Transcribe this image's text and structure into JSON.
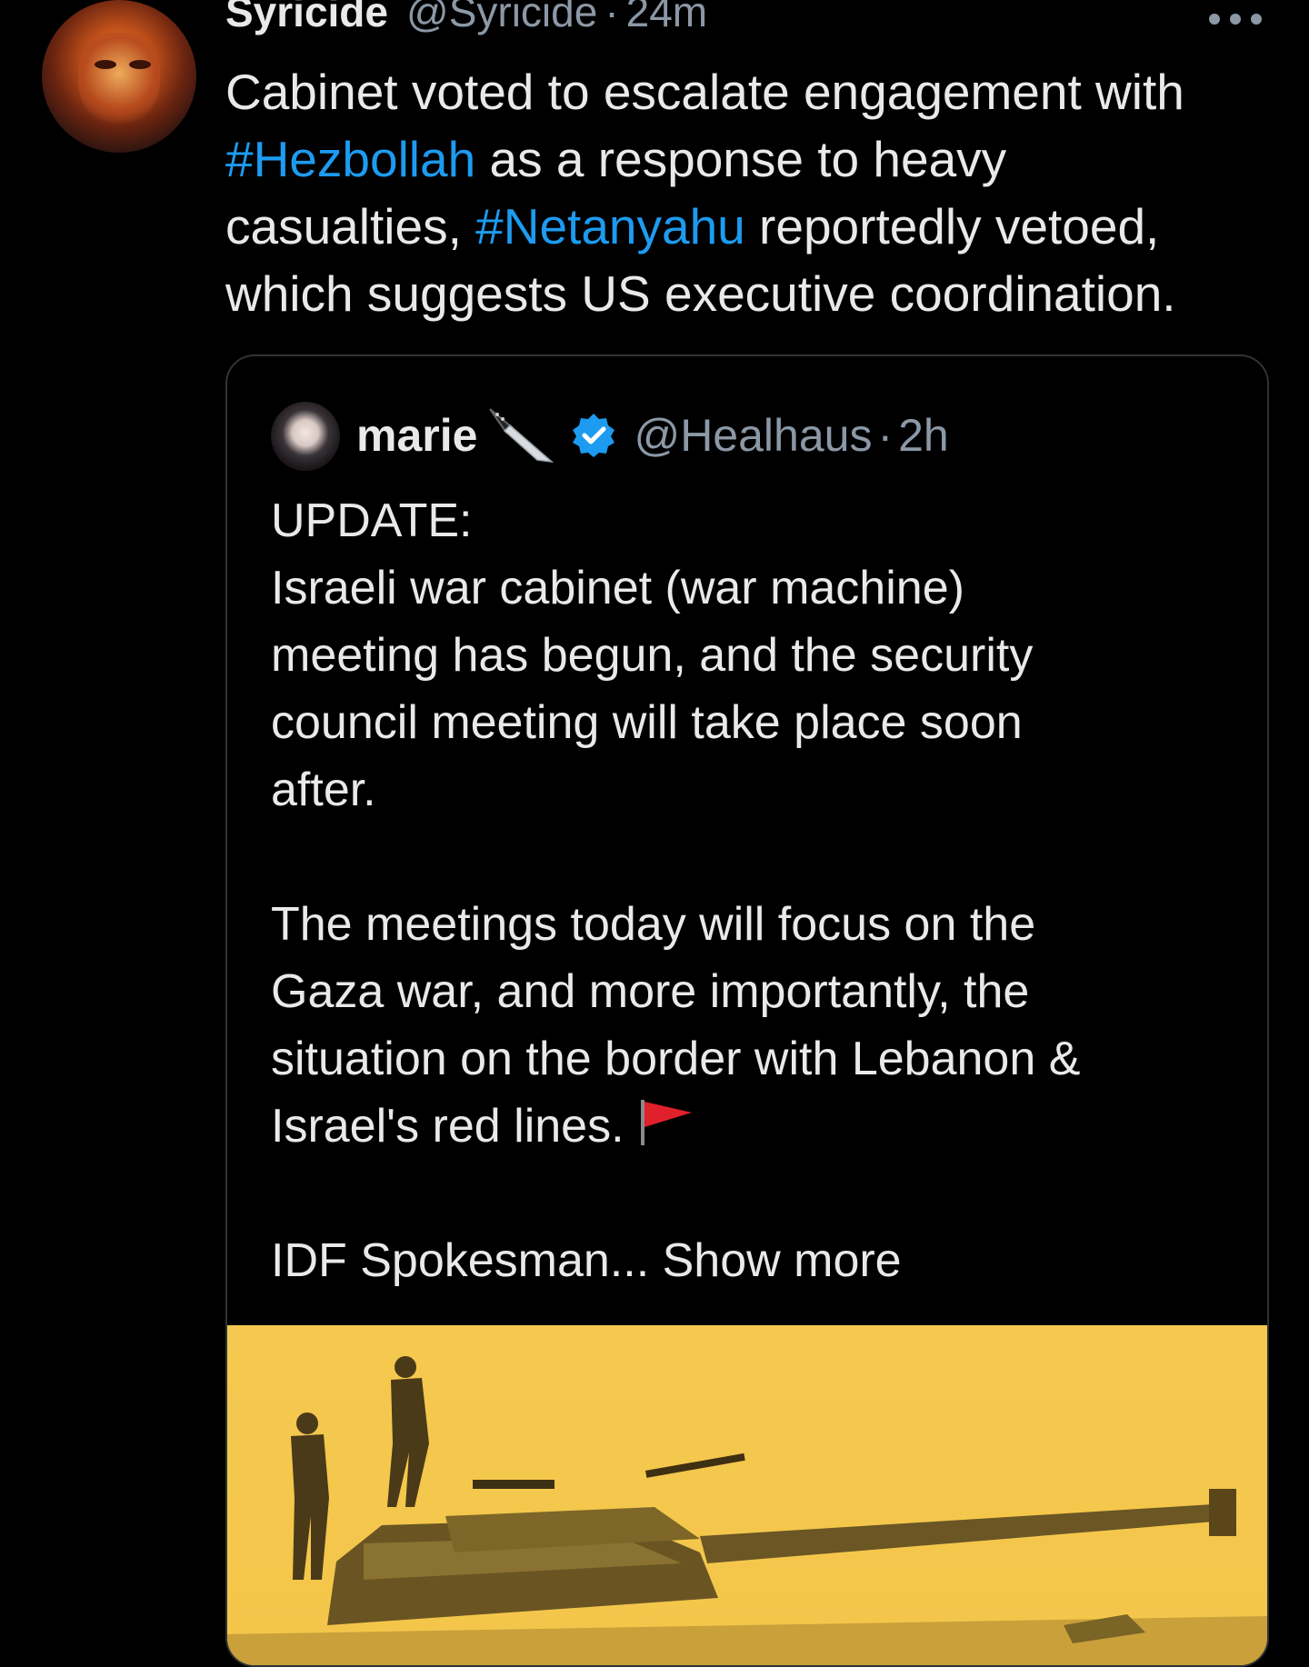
{
  "tweet": {
    "name": "Syricide",
    "handle": "@Syricide",
    "separator": "·",
    "time": "24m",
    "more_icon": "more-horizontal-icon",
    "text_lines": [
      [
        {
          "t": "Cabinet voted to escalate engagement with",
          "h": false
        }
      ],
      [
        {
          "t": "#Hezbollah",
          "h": true
        },
        {
          "t": " as a response to heavy",
          "h": false
        }
      ],
      [
        {
          "t": "casualties, ",
          "h": false
        },
        {
          "t": "#Netanyahu",
          "h": true
        },
        {
          "t": " reportedly vetoed,",
          "h": false
        }
      ],
      [
        {
          "t": "which suggests  US executive coordination.",
          "h": false
        }
      ]
    ],
    "hashtag_color": "#1d9bf0"
  },
  "quote": {
    "name": "marie",
    "name_emoji": "knife-icon",
    "verified_icon": "verified-badge-icon",
    "verified_color": "#1d9bf0",
    "handle": "@Healhaus",
    "separator": "·",
    "time": "2h",
    "lines": [
      "UPDATE:",
      "Israeli war cabinet (war machine)",
      "meeting has begun, and the security",
      "council meeting will take place soon",
      "after.",
      "",
      "The meetings today will focus on the",
      "Gaza war, and more importantly, the",
      "situation on the border with Lebanon &",
      "Israel's red lines.",
      "",
      "IDF Spokesman... Show more"
    ],
    "flag_icon": "red-flag-icon",
    "media_color": "#f5c94f"
  }
}
